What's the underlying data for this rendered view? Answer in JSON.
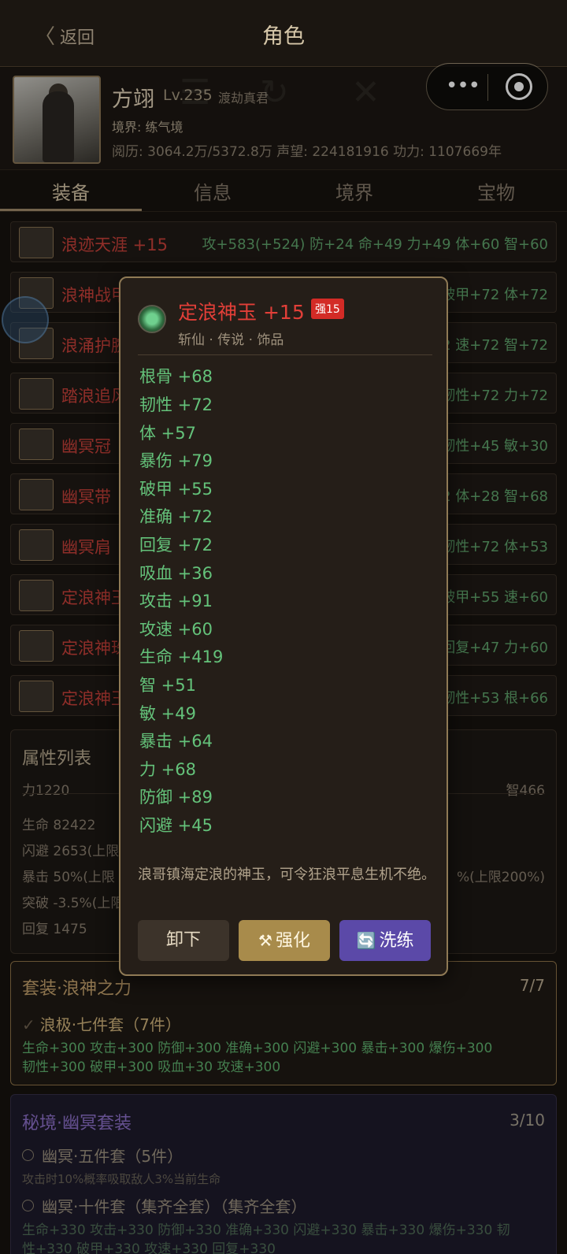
{
  "header": {
    "back_label": "返回",
    "title": "角色"
  },
  "character": {
    "name": "方翊",
    "level": "Lv.235",
    "title": "渡劫真君",
    "realm": "境界: 练气境",
    "stats_line": "阅历: 3064.2万/5372.8万   声望: 224181916   功力: 1107669年"
  },
  "tabs": [
    "装备",
    "信息",
    "境界",
    "宝物"
  ],
  "equipment": [
    {
      "name": "浪迹天涯",
      "plus": " +15",
      "stats": "攻+583(+524) 防+24 命+49 力+49 体+60 智+60"
    },
    {
      "name": "浪神战甲",
      "plus": "",
      "stats": "破甲+72 体+72"
    },
    {
      "name": "浪涌护腕",
      "plus": "",
      "stats": "72 速+72 智+72"
    },
    {
      "name": "踏浪追风",
      "plus": "",
      "stats": "韧性+72 力+72"
    },
    {
      "name": "幽冥冠",
      "plus": "",
      "stats": "韧性+45 敏+30"
    },
    {
      "name": "幽冥带",
      "plus": "",
      "stats": "2 体+28 智+68"
    },
    {
      "name": "幽冥肩",
      "plus": "",
      "stats": "韧性+72 体+53"
    },
    {
      "name": "定浪神玉",
      "plus": "",
      "stats": "破甲+55 速+60"
    },
    {
      "name": "定浪神珠",
      "plus": "",
      "stats": "回复+47 力+60"
    },
    {
      "name": "定浪神玉",
      "plus": "",
      "stats": "韧性+53 根+66"
    }
  ],
  "attributes": {
    "title": "属性列表",
    "top_left": "力1220",
    "top_right": "智466",
    "lines": [
      "生命 82422",
      "闪避 2653(上限",
      "暴击 50%(上限",
      "突破 -3.5%(上限",
      "回复 1475"
    ],
    "crit_right": "%(上限200%)"
  },
  "set": {
    "title": "套装·浪神之力",
    "count": "7/7",
    "sub": "浪极·七件套（7件）",
    "bonus_line1": "生命+300  攻击+300  防御+300  准确+300  闪避+300  暴击+300  爆伤+300",
    "bonus_line2": "韧性+300  破甲+300  吸血+30  攻速+300"
  },
  "secret": {
    "title": "秘境·幽冥套装",
    "count": "3/10",
    "five": "幽冥·五件套（5件）",
    "five_desc": "攻击时10%概率吸取敌人3%当前生命",
    "ten": "幽冥·十件套（集齐全套）（集齐全套）",
    "bonus_line1": "生命+330  攻击+330  防御+330  准确+330  闪避+330  暴击+330  爆伤+330  韧",
    "bonus_line2": "性+330  破甲+330  攻速+330  回复+330"
  },
  "popup": {
    "name": "定浪神玉",
    "plus": "+15",
    "badge": "强15",
    "subtitle": "斩仙 · 传说 · 饰品",
    "stats": [
      "根骨 +68",
      "韧性 +72",
      "体 +57",
      "暴伤 +79",
      "破甲 +55",
      "准确 +72",
      "回复 +72",
      "吸血 +36",
      "攻击 +91",
      "攻速 +60",
      "生命 +419",
      "智 +51",
      "敏 +49",
      "暴击 +64",
      "力 +68",
      "防御 +89",
      "闪避 +45"
    ],
    "description": "浪哥镇海定浪的神玉，可令狂浪平息生机不绝。",
    "btn_unequip": "卸下",
    "btn_enhance": "强化",
    "btn_refine": "洗练"
  },
  "colors": {
    "accent_gold": "#8f7448",
    "item_red": "#c8413a",
    "stat_green": "#64c27a",
    "refine_purple": "#5b49a8"
  }
}
